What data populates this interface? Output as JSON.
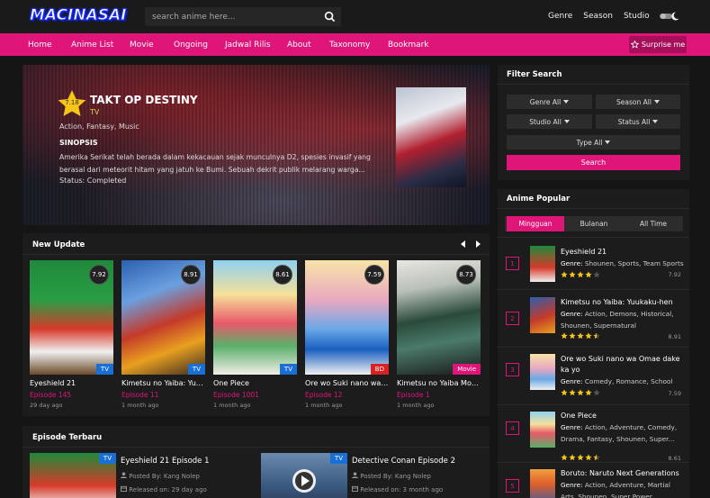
{
  "header": {
    "logo": "MACINASAI",
    "search_placeholder": "search anime here...",
    "links": [
      "Genre",
      "Season",
      "Studio"
    ]
  },
  "nav": {
    "items": [
      "Home",
      "Anime List",
      "Movie",
      "Ongoing",
      "Jadwal Rilis",
      "About",
      "Taxonomy",
      "Bookmark"
    ],
    "surprise": "Surprise me"
  },
  "hero": {
    "score": "7.18",
    "title": "TAKT OP DESTINY",
    "type": "TV",
    "genres": "Action,  Fantasy,  Music",
    "synopsis_heading": "SINOPSIS",
    "synopsis": "Amerika Serikat telah berada dalam kekacauan sejak munculnya D2, spesies invasif yang berasal dari meteorit hitam yang jatuh ke Bumi. Sebuah dekrit publik melarang warga...",
    "status": "Status: Completed"
  },
  "new_update": {
    "title": "New Update",
    "cards": [
      {
        "title": "Eyeshield 21",
        "episode": "Episode 145",
        "ago": "29 day ago",
        "score": "7.92",
        "tag": "TV",
        "tag_color": "#1a6fd6"
      },
      {
        "title": "Kimetsu no Yaiba: Yuukaku-hen",
        "episode": "Episode 11",
        "ago": "1 month ago",
        "score": "8.91",
        "tag": "TV",
        "tag_color": "#1a6fd6"
      },
      {
        "title": "One Piece",
        "episode": "Episode 1001",
        "ago": "1 month ago",
        "score": "8.61",
        "tag": "TV",
        "tag_color": "#1a6fd6"
      },
      {
        "title": "Ore wo Suki nano wa Omae dake ka yo",
        "episode": "Episode 12",
        "ago": "1 month ago",
        "score": "7.59",
        "tag": "BD",
        "tag_color": "#d62222"
      },
      {
        "title": "Kimetsu no Yaiba Movie: Mugen Ressha-hen",
        "episode": "Episode 1",
        "ago": "1 month ago",
        "score": "8.73",
        "tag": "Movie",
        "tag_color": "#e0157a"
      }
    ]
  },
  "episode_terbaru": {
    "title": "Episode Terbaru",
    "items": [
      {
        "title": "Eyeshield 21 Episode 1",
        "posted": "Posted By: Kang Nolep",
        "released": "Released on: 29 day ago",
        "tag": "TV"
      },
      {
        "title": "Detective Conan Episode 2",
        "posted": "Posted By: Kang Nolep",
        "released": "Released on: 3 month ago",
        "tag": "TV"
      }
    ]
  },
  "filter": {
    "title": "Filter Search",
    "buttons": [
      "Genre All",
      "Season All",
      "Studio All",
      "Status All",
      "Type All"
    ],
    "search": "Search"
  },
  "popular": {
    "title": "Anime Popular",
    "tabs": [
      "Mingguan",
      "Bulanan",
      "All Time"
    ],
    "items": [
      {
        "rank": "1",
        "title": "Eyeshield 21",
        "genre_label": "Genre:",
        "genres": "Shounen, Sports, Team Sports",
        "score": "7.92",
        "stars": 4
      },
      {
        "rank": "2",
        "title": "Kimetsu no Yaiba: Yuukaku-hen",
        "genre_label": "Genre:",
        "genres": "Action, Demons, Historical, Shounen, Supernatural",
        "score": "8.91",
        "stars": 4.5
      },
      {
        "rank": "3",
        "title": "Ore wo Suki nano wa Omae dake ka yo",
        "genre_label": "Genre:",
        "genres": "Comedy, Romance, School",
        "score": "7.59",
        "stars": 4
      },
      {
        "rank": "4",
        "title": "One Piece",
        "genre_label": "Genre:",
        "genres": "Action, Adventure, Comedy, Drama, Fantasy, Shounen, Super...",
        "score": "8.61",
        "stars": 4.5
      },
      {
        "rank": "5",
        "title": "Boruto: Naruto Next Generations",
        "genre_label": "Genre:",
        "genres": "Action, Adventure, Martial Arts, Shounen, Super Power",
        "score": "",
        "stars": 0
      }
    ]
  },
  "colors": {
    "accent": "#e0157a",
    "background": "#151515",
    "panel": "#1c1c1c",
    "star": "#f5c518"
  }
}
